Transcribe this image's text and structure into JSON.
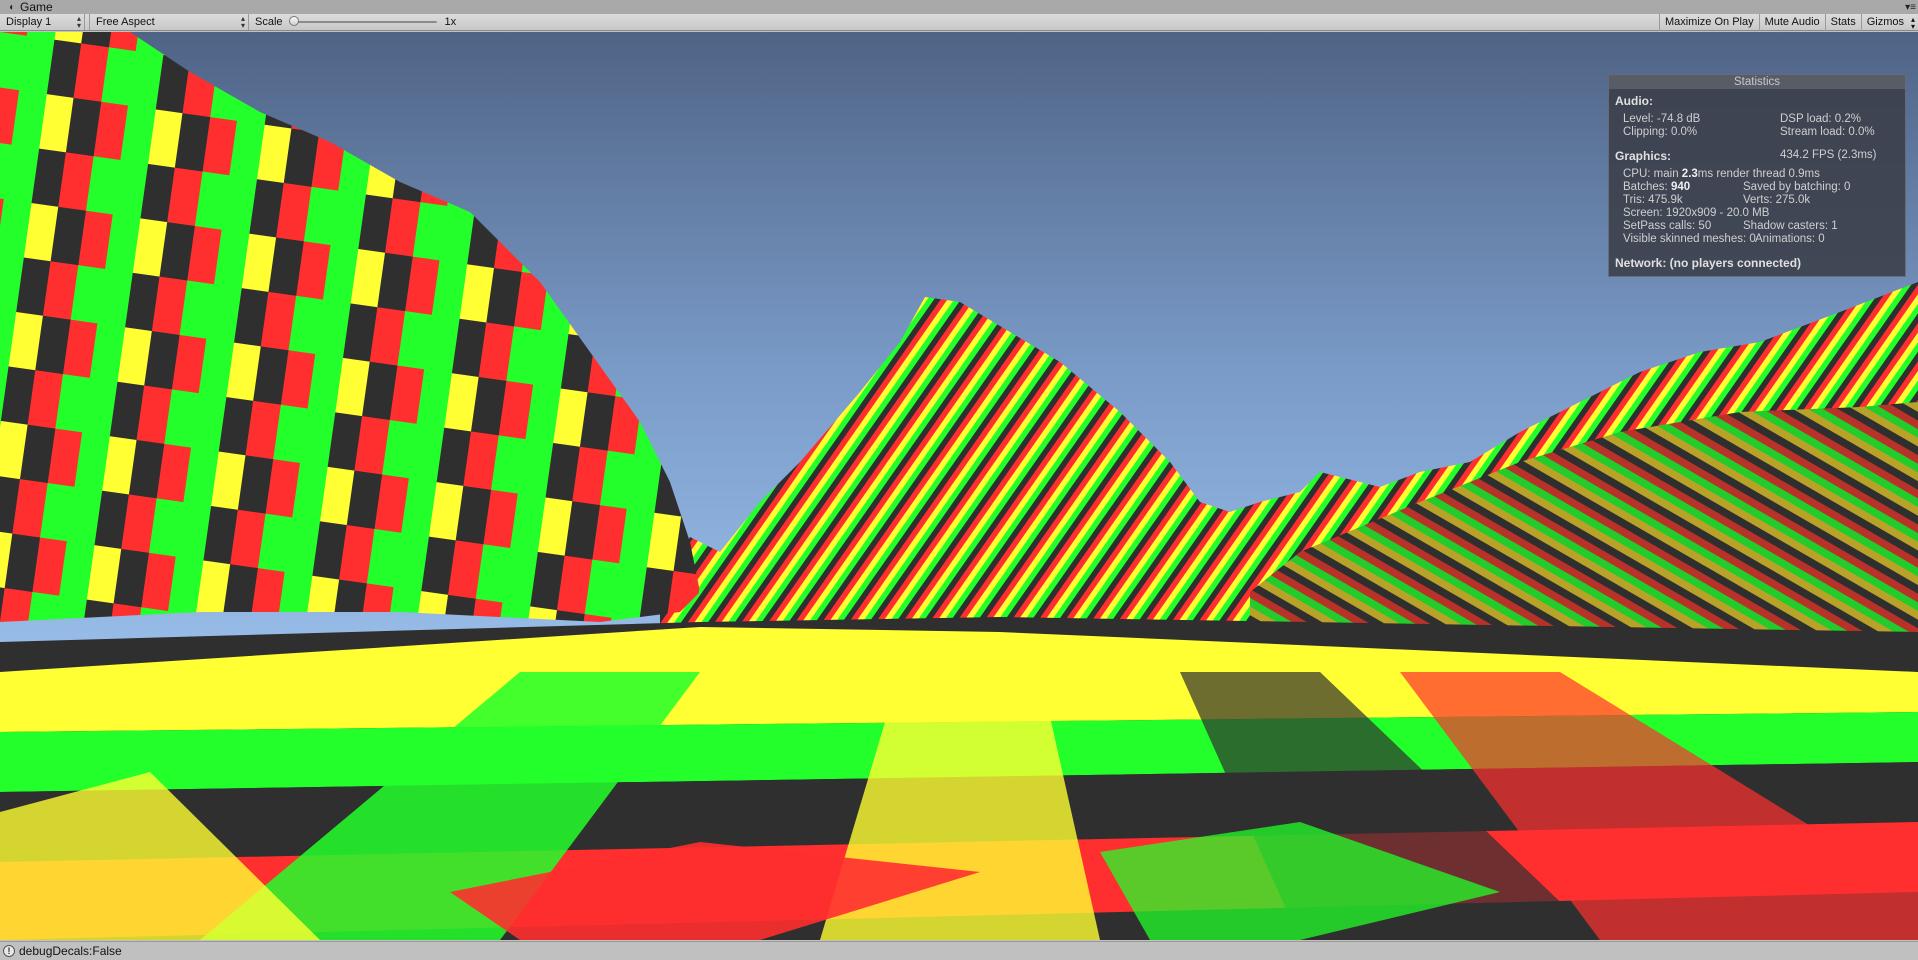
{
  "window": {
    "title": "Game",
    "icon": "unity-icon",
    "menu_icon": "window-menu-icon"
  },
  "toolbar": {
    "display": "Display 1",
    "aspect": "Free Aspect",
    "scale_label": "Scale",
    "scale_value": "1x",
    "scale_level": 0,
    "toggles": {
      "maximize": "Maximize On Play",
      "mute": "Mute Audio",
      "stats": "Stats",
      "gizmos": "Gizmos"
    }
  },
  "stats": {
    "title": "Statistics",
    "audio": {
      "header": "Audio:",
      "level": "Level: -74.8 dB",
      "clipping": "Clipping: 0.0%",
      "dsp": "DSP load: 0.2%",
      "stream": "Stream load: 0.0%"
    },
    "graphics": {
      "header": "Graphics:",
      "fps": "434.2 FPS (2.3ms)",
      "cpu_prefix": "CPU: main ",
      "cpu_main": "2.3",
      "cpu_suffix": "ms  render thread 0.9ms",
      "batches_prefix": "Batches: ",
      "batches": "940",
      "saved": "Saved by batching: 0",
      "tris": "Tris: 475.9k",
      "verts": "Verts: 275.0k",
      "screen": "Screen: 1920x909 - 20.0 MB",
      "setpass": "SetPass calls: 50",
      "shadow": "Shadow casters: 1",
      "skinned": "Visible skinned meshes: 0",
      "animations": "Animations: 0"
    },
    "network": "Network: (no players connected)"
  },
  "status": {
    "icon": "info-icon",
    "message": "debugDecals:False"
  },
  "colors": {
    "red": "#ff2f2f",
    "yellow": "#ffff33",
    "green": "#22ff2a",
    "dark": "#2f2f2f",
    "sky_top": "#4f6385",
    "sky_bottom": "#8fb3e0"
  }
}
